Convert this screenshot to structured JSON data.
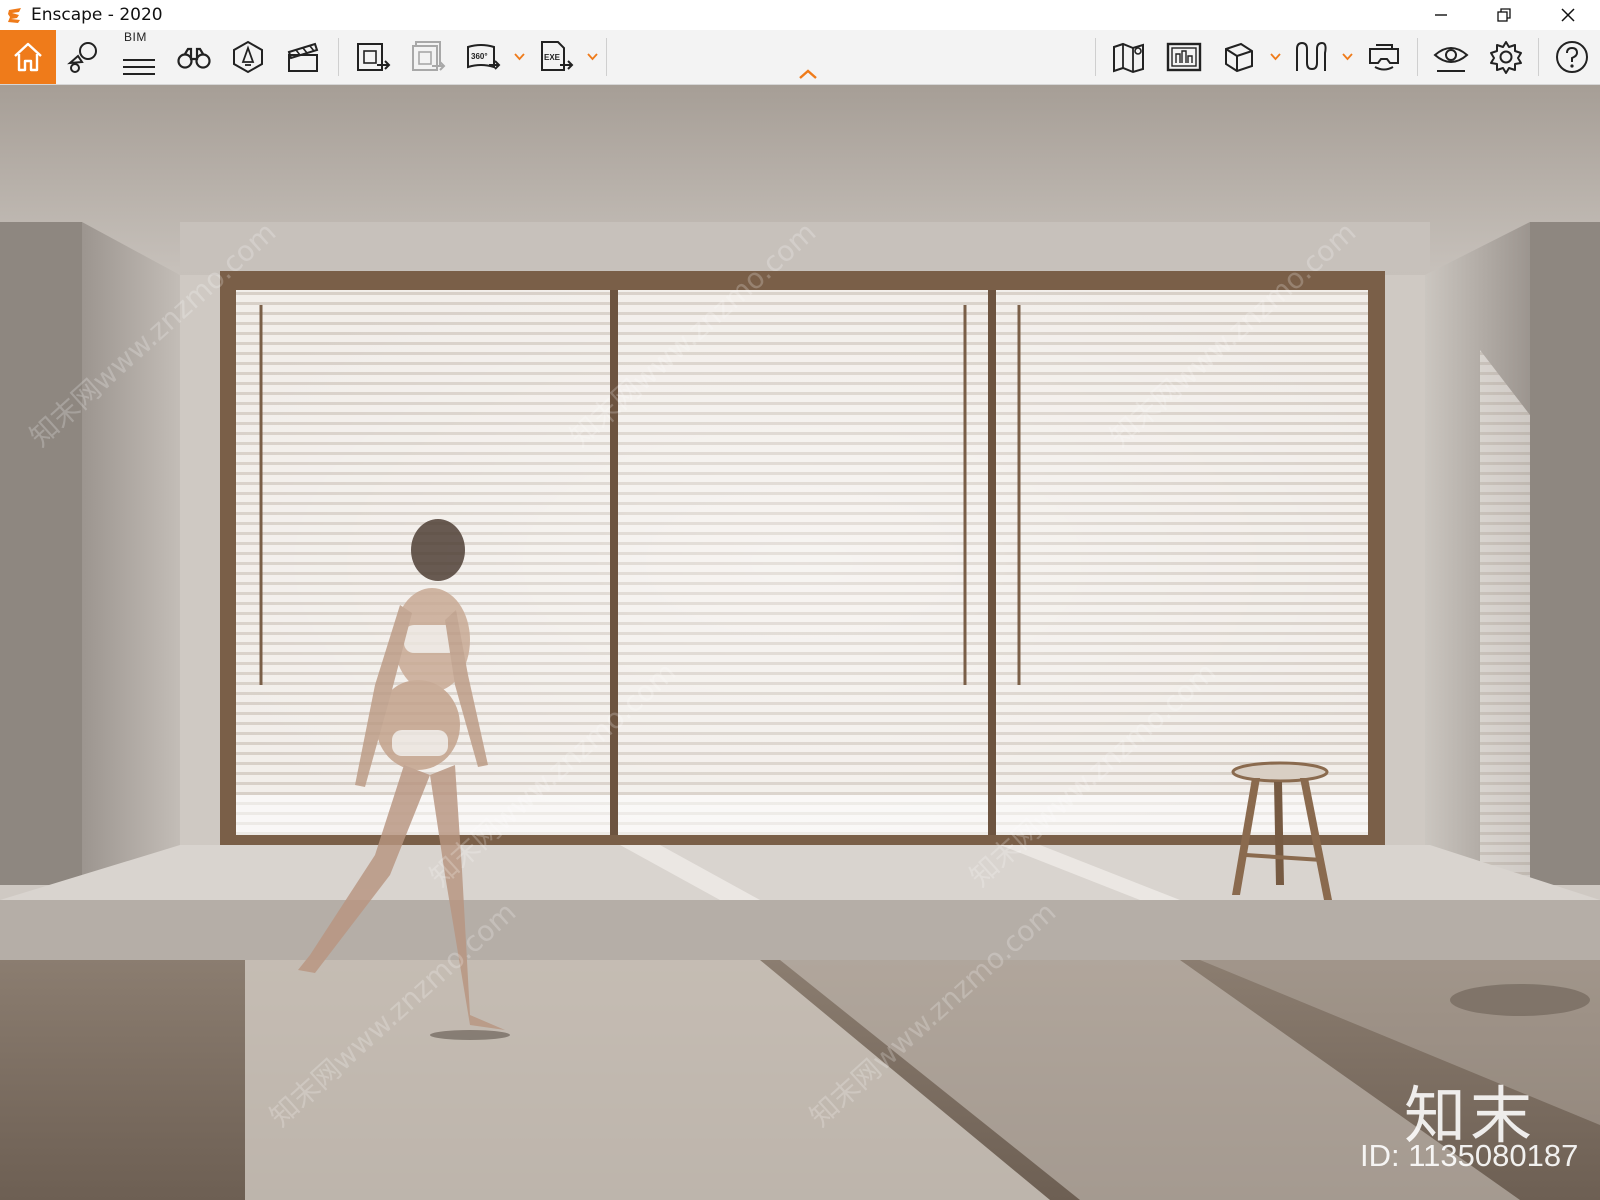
{
  "window": {
    "title": "Enscape - 2020",
    "minimize_icon": "minimize-icon",
    "restore_icon": "restore-icon",
    "close_icon": "close-icon"
  },
  "toolbar": {
    "bim_label": "BIM",
    "left_tools": [
      {
        "name": "home-icon",
        "active": true
      },
      {
        "name": "asset-library-icon"
      },
      {
        "name": "bim-icon"
      },
      {
        "name": "binoculars-icon"
      },
      {
        "name": "light-view-icon"
      },
      {
        "name": "video-editor-icon"
      },
      {
        "name": "screenshot-export-icon"
      },
      {
        "name": "batch-export-icon"
      },
      {
        "name": "panorama-360-icon"
      },
      {
        "name": "exe-export-icon"
      }
    ],
    "right_tools": [
      {
        "name": "map-icon"
      },
      {
        "name": "mini-map-icon"
      },
      {
        "name": "view-mode-cube-icon"
      },
      {
        "name": "walk-fly-icon"
      },
      {
        "name": "vr-headset-icon"
      },
      {
        "name": "visual-settings-eye-icon"
      },
      {
        "name": "settings-gear-icon"
      },
      {
        "name": "help-icon"
      }
    ],
    "accent_color": "#ef7b1a"
  },
  "viewport": {
    "watermark_brand": "知末",
    "watermark_id": "ID: 1135080187",
    "watermark_site": "知末网www.znzmo.com"
  }
}
